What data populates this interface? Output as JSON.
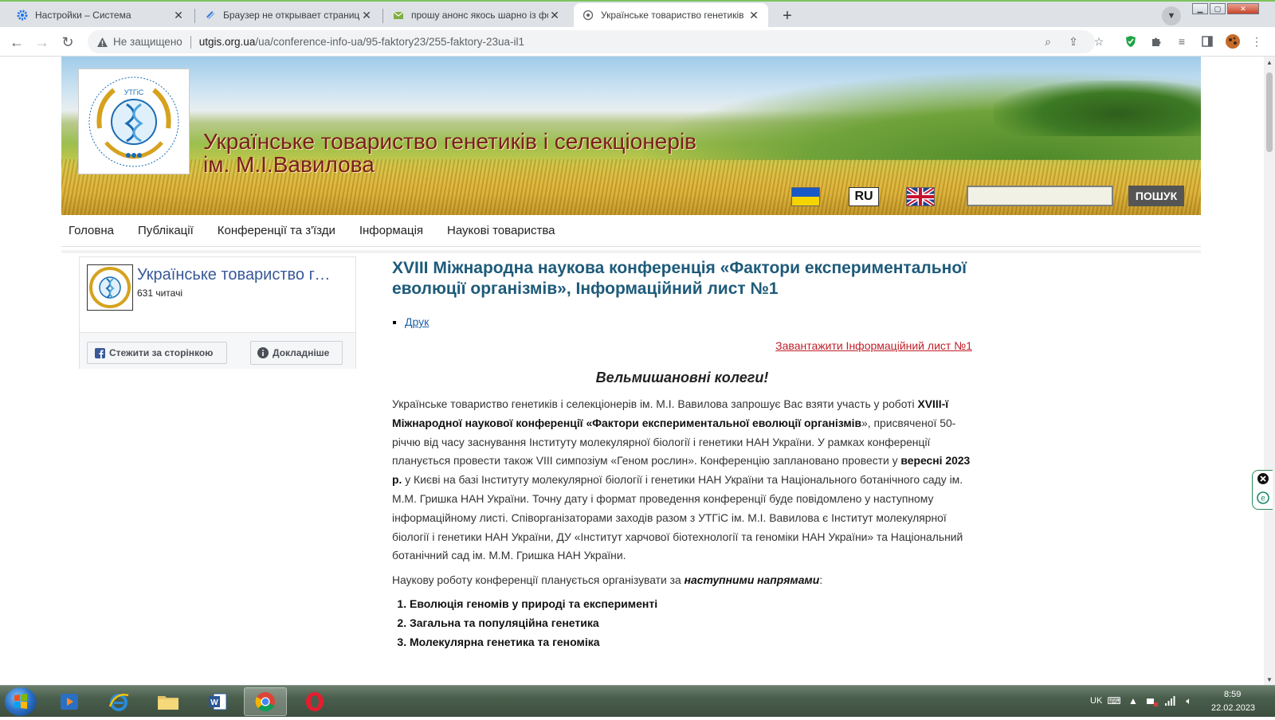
{
  "browser": {
    "tabs": [
      {
        "title": "Настройки – Система",
        "icon": "gear-icon",
        "active": false
      },
      {
        "title": "Браузер не открывает страницы",
        "icon": "document-icon",
        "active": false
      },
      {
        "title": "прошу анонс якось шарно із фо",
        "icon": "mail-icon",
        "active": false
      },
      {
        "title": "Українське товариство генетиків",
        "icon": "globe-icon",
        "active": true
      }
    ],
    "new_tab_label": "+",
    "security_label": "Не защищено",
    "url_host": "utgis.org.ua",
    "url_path": "/ua/conference-info-ua/95-faktory23/255-faktory-23ua-il1"
  },
  "site": {
    "title_line1": "Українське товариство генетиків і селекціонерів",
    "title_line2": "ім. М.І.Вавилова",
    "logo_text": "УТГіС",
    "lang_ru": "RU",
    "search_button": "ПОШУК",
    "search_placeholder": "",
    "nav": [
      "Головна",
      "Публікації",
      "Конференції та з'їзди",
      "Інформація",
      "Наукові товариства"
    ]
  },
  "facebook": {
    "page_name": "Українське товариство генетиків і селекціонерів",
    "followers": "631 читачі",
    "follow_button": "Стежити за сторінкою",
    "more_button": "Докладніше"
  },
  "article": {
    "title_prefix": "XVIII",
    "title_rest": " Міжнародна наукова конференція «Фактори експериментальної еволюції організмів», Інформаційний лист №1",
    "print_link": "Друк",
    "download_link": "Завантажити Інформаційний лист №1",
    "greeting": "Вельмишановні колеги!",
    "p1_a": "Українське товариство генетиків і селекціонерів ім. М.І. Вавилова запрошує Вас взяти участь у роботі ",
    "p1_b": "XVIII-ї Міжнародної наукової конференції «Фактори експериментальної еволюції організмів",
    "p1_c": "», присвяченої 50-річчю від часу заснування Інституту молекулярної біології і генетики НАН України. У рамках конференції планується провести також VIII симпозіум «Геном рослин». Конференцію заплановано провести у ",
    "p1_d": "вересні 2023 р.",
    "p1_e": " у Києві на базі Інституту молекулярної біології і генетики НАН України та Національного ботанічного саду ім. М.М. Гришка НАН України. Точну дату і формат проведення конференції буде повідомлено у наступному інформаційному листі. Співорганізаторами заходів разом з УТГіС ім. М.І. Вавилова є Інститут молекулярної біології і генетики НАН України, ДУ «Інститут харчової біотехнології та геноміки НАН України» та Національний ботанічний сад ім. М.М. Гришка НАН України.",
    "p2_a": "Наукову роботу конференції планується організувати за ",
    "p2_b": "наступними напрямами",
    "p2_c": ":",
    "directions": [
      "Еволюція геномів у природі та експерименті",
      "Загальна та популяційна генетика",
      "Молекулярна генетика та геноміка"
    ]
  },
  "taskbar": {
    "lang": "UK",
    "time": "8:59",
    "date": "22.02.2023"
  },
  "colors": {
    "accent_green": "#7cc45c",
    "title_red": "#7a1e1e",
    "article_title": "#1e5b7a",
    "download_red": "#c0202a",
    "fb_blue": "#385898"
  }
}
